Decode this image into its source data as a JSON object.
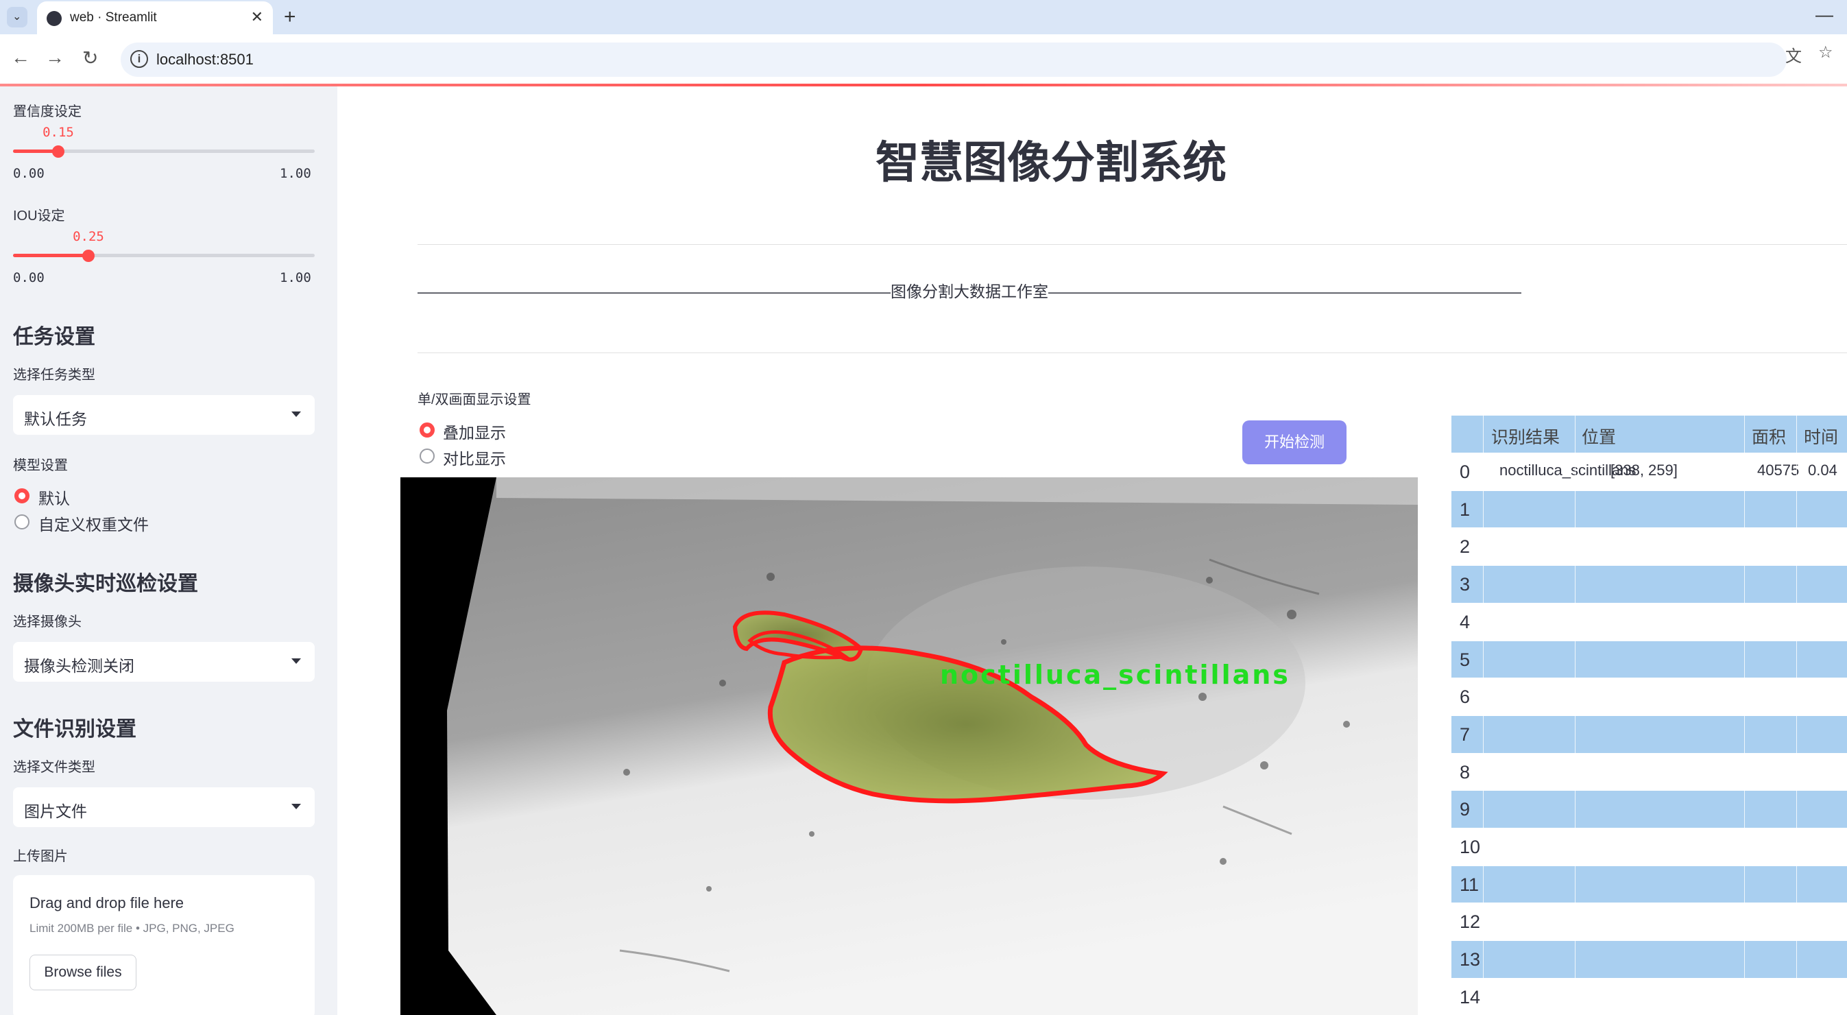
{
  "browser": {
    "tab_title": "web · Streamlit",
    "url": "localhost:8501"
  },
  "sidebar": {
    "confidence": {
      "label": "置信度设定",
      "value": "0.15",
      "fraction": 0.15,
      "min": "0.00",
      "max": "1.00"
    },
    "iou": {
      "label": "IOU设定",
      "value": "0.25",
      "fraction": 0.25,
      "min": "0.00",
      "max": "1.00"
    },
    "task_heading": "任务设置",
    "task_type_label": "选择任务类型",
    "task_type_value": "默认任务",
    "model_label": "模型设置",
    "model_options": [
      "默认",
      "自定义权重文件"
    ],
    "camera_heading": "摄像头实时巡检设置",
    "camera_label": "选择摄像头",
    "camera_value": "摄像头检测关闭",
    "file_heading": "文件识别设置",
    "file_type_label": "选择文件类型",
    "file_type_value": "图片文件",
    "upload_label": "上传图片",
    "upload_title": "Drag and drop file here",
    "upload_limit": "Limit 200MB per file • JPG, PNG, JPEG",
    "browse_label": "Browse files"
  },
  "main": {
    "title": "智慧图像分割系统",
    "subtitle_line": "——————————————————————————————图像分割大数据工作室——————————————————————————————",
    "display_label": "单/双画面显示设置",
    "display_options": [
      "叠加显示",
      "对比显示"
    ],
    "start_button": "开始检测",
    "detection_label": "noctilluca_scintillans"
  },
  "table": {
    "headers": [
      "识别结果",
      "位置",
      "面积",
      "时间"
    ],
    "rows": [
      {
        "idx": "0",
        "result": "noctilluca_scintillans",
        "position": "[338, 259]",
        "area": "40575",
        "time": "0.04"
      },
      {
        "idx": "1"
      },
      {
        "idx": "2"
      },
      {
        "idx": "3"
      },
      {
        "idx": "4"
      },
      {
        "idx": "5"
      },
      {
        "idx": "6"
      },
      {
        "idx": "7"
      },
      {
        "idx": "8"
      },
      {
        "idx": "9"
      },
      {
        "idx": "10"
      },
      {
        "idx": "11"
      },
      {
        "idx": "12"
      },
      {
        "idx": "13"
      },
      {
        "idx": "14"
      }
    ]
  },
  "colors": {
    "accent": "#ff4b4b",
    "button": "#8c8df0",
    "table_stripe": "#a9cff0",
    "sidebar_bg": "#f0f2f6"
  }
}
